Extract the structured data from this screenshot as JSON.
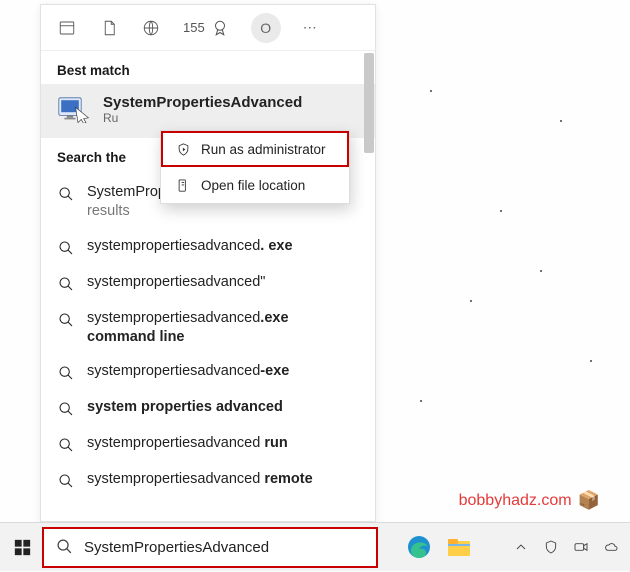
{
  "top": {
    "count": "155",
    "avatar_initial": "O"
  },
  "best_match": {
    "header": "Best match",
    "title": "SystemPropertiesAdvanced",
    "subtitle": "Ru"
  },
  "context_menu": {
    "run_admin": "Run as administrator",
    "open_location": "Open file location"
  },
  "search_web_header": "Search the",
  "results": [
    {
      "prefix": "System",
      "mid": "PropertiesAdvanced",
      "tail": " - See web results"
    },
    {
      "prefix": "systempropertiesadvanced",
      "bold_suffix": ". exe"
    },
    {
      "prefix": "systempropertiesadvanced",
      "suffix": "\""
    },
    {
      "prefix": "systempropertiesadvanced",
      "bold_suffix": ".exe command line"
    },
    {
      "prefix": "systempropertiesadvanced",
      "bold_suffix": "-exe"
    },
    {
      "all_bold": "system properties advanced"
    },
    {
      "prefix": "systempropertiesadvanced ",
      "bold_suffix": "run"
    },
    {
      "prefix": "systempropertiesadvanced ",
      "bold_suffix": "remote"
    }
  ],
  "search_box": {
    "value": "SystemPropertiesAdvanced"
  },
  "watermark": "bobbyhadz.com"
}
